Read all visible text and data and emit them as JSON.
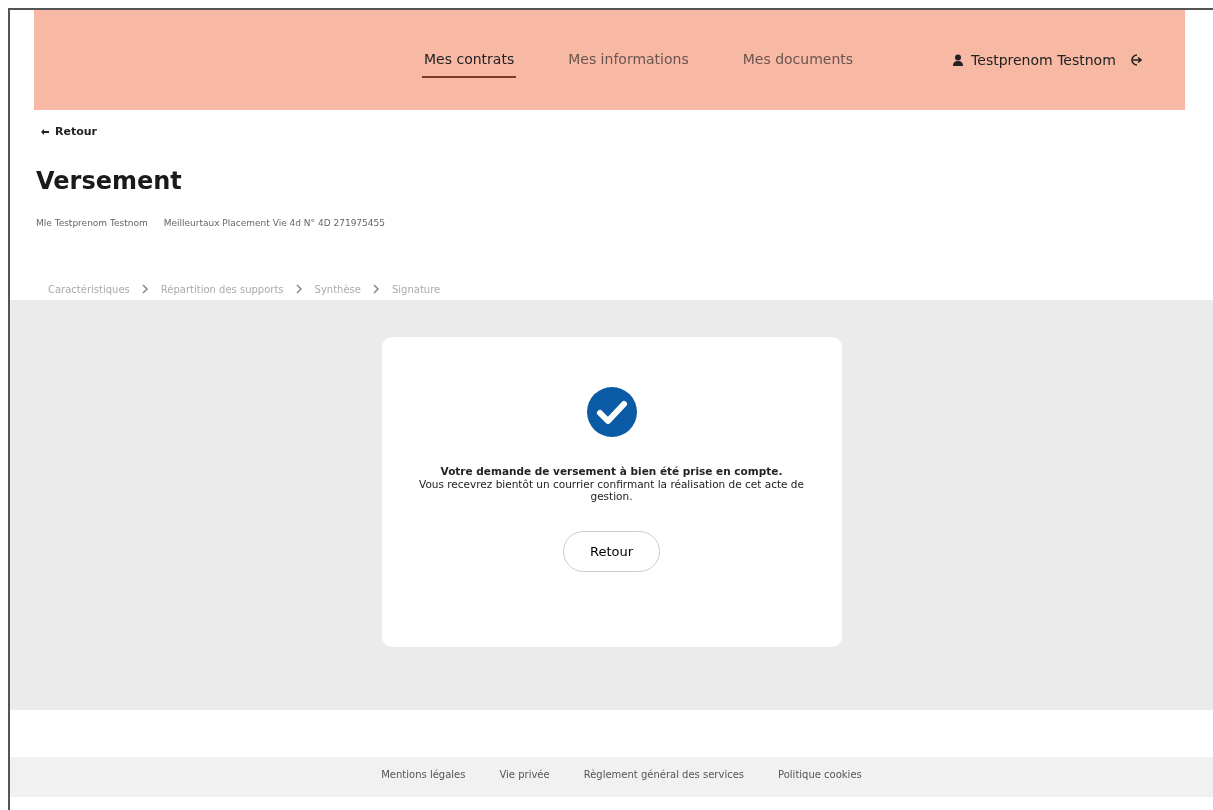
{
  "header": {
    "nav": [
      {
        "label": "Mes contrats",
        "selected": true
      },
      {
        "label": "Mes informations",
        "selected": false
      },
      {
        "label": "Mes documents",
        "selected": false
      }
    ],
    "user": "Testprenom Testnom"
  },
  "back_link": "Retour",
  "title": "Versement",
  "subtitle": [
    "Mle Testprenom Testnom",
    "Meilleurtaux Placement Vie 4d N° 4D 271975455"
  ],
  "steps": [
    {
      "label": "Caractéristiques",
      "selected": false
    },
    {
      "label": "Répartition des supports",
      "selected": false
    },
    {
      "label": "Synthèse",
      "selected": false
    },
    {
      "label": "Signature",
      "selected": false
    }
  ],
  "confirmation": {
    "title": "Votre demande de versement à bien été prise en compte.",
    "message": "Vous recevrez bientôt un courrier confirmant la réalisation de cet acte de gestion.",
    "button": "Retour"
  },
  "footer": [
    "Mentions légales",
    "Vie privée",
    "Règlement général des services",
    "Politique cookies"
  ]
}
